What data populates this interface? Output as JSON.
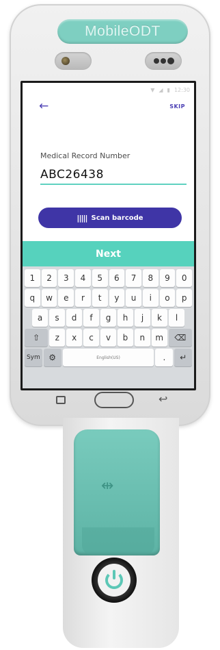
{
  "device": {
    "brand": "MobileODT",
    "icons": {
      "camera_left": "camera-lens-icon",
      "camera_right": "sensor-dots-icon",
      "usb": "usb-icon",
      "power": "power-icon"
    },
    "colors": {
      "teal": "#7ecfc1",
      "accent": "#3f35a6"
    }
  },
  "status_bar": {
    "time": "12:30",
    "icons": [
      "wifi-icon",
      "signal-icon",
      "battery-icon"
    ]
  },
  "app_bar": {
    "back_icon": "back-arrow-icon",
    "skip_label": "SKIP"
  },
  "form": {
    "field_label": "Medical Record Number",
    "field_value": "ABC26438"
  },
  "scan_button": {
    "icon": "barcode-icon",
    "label": "Scan barcode"
  },
  "next_button": {
    "label": "Next"
  },
  "keyboard": {
    "row1": [
      "1",
      "2",
      "3",
      "4",
      "5",
      "6",
      "7",
      "8",
      "9",
      "0"
    ],
    "row2": [
      "q",
      "w",
      "e",
      "r",
      "t",
      "y",
      "u",
      "i",
      "o",
      "p"
    ],
    "row3": [
      "a",
      "s",
      "d",
      "f",
      "g",
      "h",
      "j",
      "k",
      "l"
    ],
    "row4": [
      "z",
      "x",
      "c",
      "v",
      "b",
      "n",
      "m"
    ],
    "shift": "⇧",
    "backspace": "⌫",
    "sym": "Sym",
    "settings": "⚙",
    "space": "English(US)",
    "period": ".",
    "enter": "↵"
  },
  "nav": {
    "recent": "recent-apps-icon",
    "home": "home-icon",
    "back": "back-icon"
  }
}
